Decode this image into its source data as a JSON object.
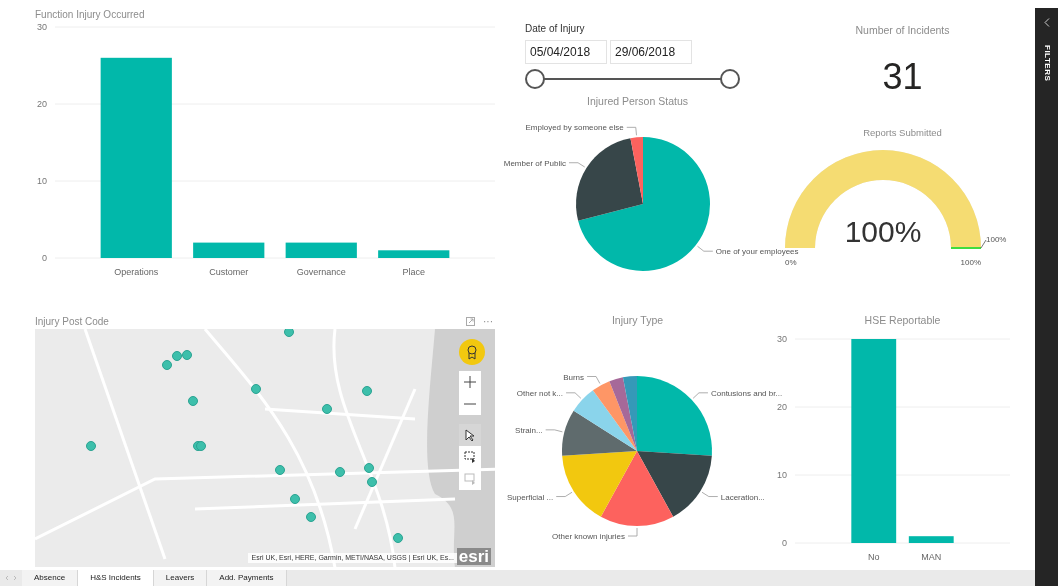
{
  "function_chart": {
    "title": "Function Injury Occurred",
    "chart_data": {
      "type": "bar",
      "categories": [
        "Operations",
        "Customer",
        "Governance",
        "Place"
      ],
      "values": [
        26,
        2,
        2,
        1
      ],
      "ylim": [
        0,
        30
      ],
      "yticks": [
        0,
        10,
        20,
        30
      ]
    }
  },
  "date_slicer": {
    "title": "Date of Injury",
    "start": "05/04/2018",
    "end": "29/06/2018"
  },
  "person_status": {
    "title": "Injured Person Status",
    "chart_data": {
      "type": "pie",
      "categories": [
        "One of your employees",
        "Member of Public",
        "Employed by someone else"
      ],
      "values": [
        71,
        26,
        3
      ],
      "colors": [
        "#01b8aa",
        "#374649",
        "#fd625e"
      ]
    }
  },
  "incidents_card": {
    "title": "Number of Incidents",
    "value": "31"
  },
  "reports_gauge": {
    "title": "Reports Submitted",
    "value": "100%",
    "level": 1,
    "min_label": "0%",
    "max_label": "100%",
    "target_label": "100%"
  },
  "map": {
    "title": "Injury Post Code",
    "more": "···",
    "attribution": "Esri UK, Esri, HERE, Garmin, METI/NASA, USGS | Esri UK, Es...",
    "logo": "esri"
  },
  "injury_type": {
    "title": "Injury Type",
    "chart_data": {
      "type": "pie",
      "categories": [
        "Contusions and br...",
        "Laceration...",
        "Other known injuries",
        "Superficial ...",
        "Strain...",
        "Other not k...",
        "Burns",
        null,
        null
      ],
      "values": [
        26,
        16,
        16,
        16,
        10,
        6,
        4,
        3,
        3
      ],
      "colors": [
        "#01b8aa",
        "#374649",
        "#fd625e",
        "#f2c80f",
        "#5f6b6d",
        "#8ad4eb",
        "#fe9666",
        "#a66999",
        "#3599b8"
      ]
    }
  },
  "hse_chart": {
    "title": "HSE Reportable",
    "chart_data": {
      "type": "bar",
      "categories": [
        "No",
        "MAN"
      ],
      "values": [
        30,
        1
      ],
      "ylim": [
        0,
        30
      ],
      "yticks": [
        0,
        10,
        20,
        30
      ]
    }
  },
  "tabs": [
    {
      "label": "Absence",
      "selected": false
    },
    {
      "label": "H&S Incidents",
      "selected": true
    },
    {
      "label": "Leavers",
      "selected": false
    },
    {
      "label": "Add. Payments",
      "selected": false
    }
  ],
  "filters_pane": {
    "label": "FILTERS"
  }
}
